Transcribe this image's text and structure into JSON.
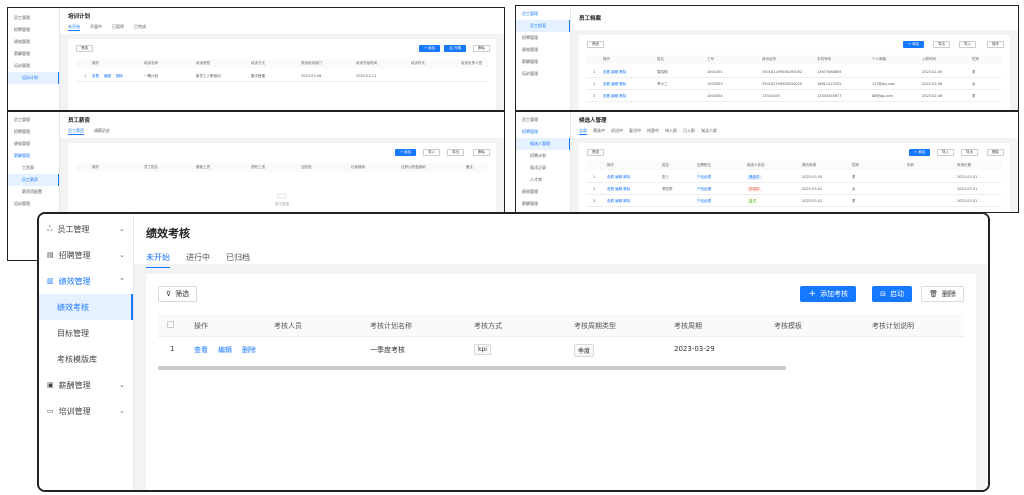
{
  "card1": {
    "sidebar": [
      "员工管理",
      "招聘管理",
      "绩效管理",
      "薪酬管理",
      "培训管理"
    ],
    "sidebar_sub": "培训计划",
    "title": "培训计划",
    "tabs": [
      "未开始",
      "开展中",
      "已暂停",
      "已完成"
    ],
    "filter": "筛选",
    "buttons": [
      "+ 添加",
      "启 开展",
      "删除"
    ],
    "headers": [
      "操作",
      "培训名称",
      "培训类型",
      "培训方式",
      "参加培训部门",
      "培训开始时间",
      "培训时长",
      "培训负责人签"
    ],
    "row": {
      "idx": "1",
      "ops": [
        "查看",
        "编辑",
        "删除"
      ],
      "name": "一期计划",
      "type": "新员工入职培训",
      "mode": "集中授课",
      "date": "2023-03-06",
      "end": "2023-03-11"
    }
  },
  "card2": {
    "sidebar": [
      "员工管理",
      "员工档案",
      "招聘管理",
      "绩效管理",
      "薪酬管理",
      "培训管理"
    ],
    "title": "员工档案",
    "filter": "筛选",
    "buttons": [
      "+ 添加",
      "导出",
      "导入",
      "操作"
    ],
    "headers": [
      "",
      "操作",
      "姓名",
      "工号",
      "身份证号",
      "手机号码",
      "个人邮箱",
      "入职时间",
      "性别"
    ],
    "rows": [
      {
        "idx": "1",
        "name": "袁晓明",
        "no": "1001001",
        "id": "350181199008294052",
        "phone": "13677668855",
        "mail": "",
        "date": "2023-02-05",
        "sex": "男"
      },
      {
        "idx": "2",
        "name": "李小三",
        "no": "1003003",
        "id": "350181199008294020",
        "phone": "18611223322",
        "mail": "123@qq.com",
        "date": "2023-02-06",
        "sex": "女"
      },
      {
        "idx": "3",
        "name": "",
        "no": "1004004",
        "id": "13344455",
        "phone": "13344455677",
        "mail": "88@qq.com",
        "date": "2023-02-06",
        "sex": "男"
      }
    ]
  },
  "card3": {
    "sidebar": [
      "员工管理",
      "招聘管理",
      "绩效管理",
      "薪酬管理",
      "工资表",
      "员工薪资",
      "薪资项配置",
      "培训管理"
    ],
    "title": "员工薪资",
    "tabs": [
      "员工薪资",
      "调薪历史"
    ],
    "filter": "筛选",
    "buttons": [
      "+ 添加",
      "导入",
      "导出",
      "删除"
    ],
    "headers": [
      "操作",
      "员工姓名",
      "基础工资",
      "绩效工资",
      "加班费",
      "社保缴纳",
      "住房公积金缴纳",
      "备注"
    ],
    "empty": "暂无数据"
  },
  "card4": {
    "sidebar": [
      "员工管理",
      "招聘管理",
      "候选人管理",
      "招聘计划",
      "面试记录",
      "人才库",
      "绩效管理",
      "薪酬管理"
    ],
    "title": "候选人管理",
    "tabs": [
      "全部",
      "筛选中",
      "初试中",
      "复试中",
      "终面中",
      "待入职",
      "已入职",
      "淘汰人群"
    ],
    "filter": "筛选",
    "buttons": [
      "+ 添加",
      "导入",
      "导出",
      "删除"
    ],
    "headers": [
      "",
      "操作",
      "姓名",
      "应聘职位",
      "候选人状态",
      "简历来源",
      "性别",
      "年龄",
      "申请日期"
    ],
    "rows": [
      {
        "idx": "1",
        "name": "张三",
        "job": "产品经理",
        "status": "筛选中",
        "src": "2023-03-05",
        "sex": "男",
        "age": "",
        "date": "2023-03-01"
      },
      {
        "idx": "2",
        "name": "李四李",
        "job": "产品经理",
        "status": "初试中",
        "src": "2023-03-02",
        "sex": "女",
        "age": "",
        "date": "2023-03-01"
      },
      {
        "idx": "3",
        "name": "",
        "job": "产品经理",
        "status": "复试",
        "src": "2023-03-02",
        "sex": "男",
        "age": "",
        "date": "2023-03-01"
      }
    ]
  },
  "main": {
    "sidebar": [
      {
        "label": "员工管理",
        "icon": "person-icon",
        "glyph": "ஃ"
      },
      {
        "label": "招聘管理",
        "icon": "document-icon",
        "glyph": "▤"
      },
      {
        "label": "绩效管理",
        "icon": "chart-icon",
        "glyph": "▥"
      },
      {
        "label": "绩效考核",
        "sub": true
      },
      {
        "label": "目标管理",
        "sub": true
      },
      {
        "label": "考核模版库",
        "sub": true
      },
      {
        "label": "薪酬管理",
        "icon": "wallet-icon",
        "glyph": "▣"
      },
      {
        "label": "培训管理",
        "icon": "monitor-icon",
        "glyph": "▭"
      }
    ],
    "title": "绩效考核",
    "tabs": [
      "未开始",
      "进行中",
      "已归档"
    ],
    "filter": "筛选",
    "add": "添加考核",
    "start": "启动",
    "delete": "删除",
    "headers": [
      "操作",
      "考核人员",
      "考核计划名称",
      "考核方式",
      "考核周期类型",
      "考核周期",
      "考核模板",
      "考核计划说明"
    ],
    "row": {
      "idx": "1",
      "view": "查看",
      "edit": "编辑",
      "del": "删除",
      "plan": "一季度考核",
      "mode": "kpi",
      "cycle_type": "季度",
      "cycle": "2023-03-29"
    }
  }
}
